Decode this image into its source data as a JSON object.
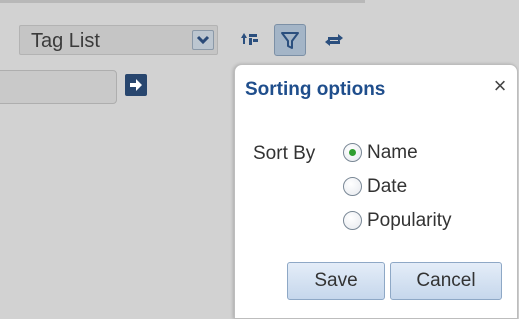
{
  "toolbar": {
    "view_select_value": "Tag List",
    "icons": {
      "dropdown": "chevron-down-icon",
      "collapse": "collapse-tree-icon",
      "filter": "filter-icon",
      "swap": "swap-arrows-icon",
      "go": "arrow-right-icon"
    }
  },
  "search": {
    "value": "",
    "placeholder": ""
  },
  "popup": {
    "title": "Sorting options",
    "close_label": "×",
    "sort_by_label": "Sort By",
    "options": [
      {
        "label": "Name",
        "selected": true
      },
      {
        "label": "Date",
        "selected": false
      },
      {
        "label": "Popularity",
        "selected": false
      }
    ],
    "save_label": "Save",
    "cancel_label": "Cancel"
  },
  "colors": {
    "title": "#1f4e8c",
    "accent_dark": "#28466e",
    "radio_selected": "#2f9e2f",
    "button_border": "#8ea8c6"
  }
}
